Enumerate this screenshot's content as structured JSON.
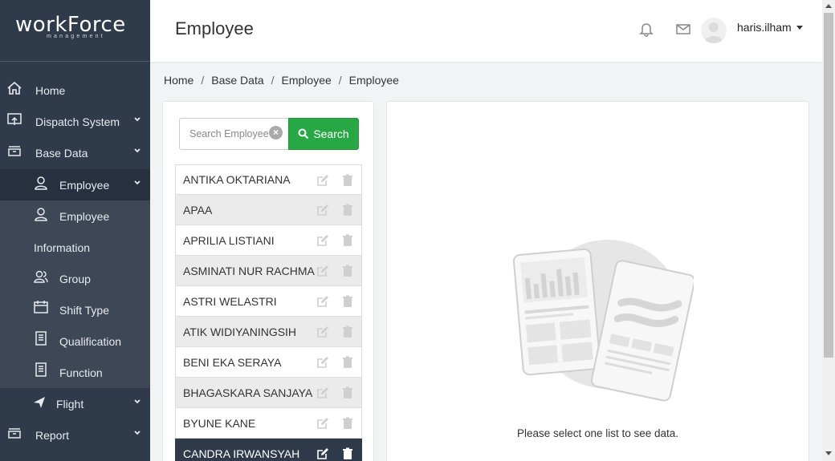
{
  "app": {
    "logo_main": "workForce",
    "logo_sub": "management"
  },
  "sidebar": {
    "items": [
      {
        "label": "Home",
        "icon": "home-icon"
      },
      {
        "label": "Dispatch System",
        "icon": "dispatch-icon",
        "expandable": true
      },
      {
        "label": "Base Data",
        "icon": "inbox-icon",
        "expandable": true
      },
      {
        "label": "Employee",
        "icon": "user-icon",
        "expandable": true
      },
      {
        "label": "Employee",
        "icon": "user-icon"
      },
      {
        "label": "Information"
      },
      {
        "label": "Group",
        "icon": "group-icon"
      },
      {
        "label": "Shift Type",
        "icon": "calendar-icon"
      },
      {
        "label": "Qualification",
        "icon": "document-icon"
      },
      {
        "label": "Function",
        "icon": "document-icon"
      },
      {
        "label": "Flight",
        "icon": "plane-icon",
        "expandable": true
      },
      {
        "label": "Report",
        "icon": "inbox-icon",
        "expandable": true
      }
    ]
  },
  "header": {
    "title": "Employee",
    "username": "haris.ilham"
  },
  "breadcrumb": [
    "Home",
    "Base Data",
    "Employee",
    "Employee"
  ],
  "search": {
    "placeholder": "Search Employee",
    "button_label": "Search"
  },
  "employees": [
    "ANTIKA OKTARIANA",
    "APAA",
    "APRILIA LISTIANI",
    "ASMINATI NUR RACHMA",
    "ASTRI WELASTRI",
    "ATIK WIDIYANINGSIH",
    "BENI EKA SERAYA",
    "BHAGASKARA SANJAYA",
    "BYUNE KANE",
    "CANDRA IRWANSYAH"
  ],
  "empty_state": {
    "message": "Please select one list to see data."
  },
  "colors": {
    "sidebar_bg": "#2f3a4b",
    "accent_green": "#27a844",
    "active_row": "#2f3a4b"
  }
}
